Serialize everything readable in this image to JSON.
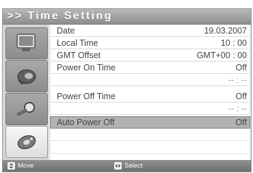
{
  "header": {
    "title": ">> Time Setting"
  },
  "sidebar": {
    "tabs": [
      {
        "icon": "tv-icon"
      },
      {
        "icon": "speaker-icon"
      },
      {
        "icon": "magnifier-icon"
      },
      {
        "icon": "settings-disc-icon",
        "active": true
      }
    ]
  },
  "settings": {
    "rows": [
      {
        "label": "Date",
        "value": "19.03.2007"
      },
      {
        "label": "Local Time",
        "value": "10 : 00"
      },
      {
        "label": "GMT Offset",
        "value": "GMT+00 : 00"
      },
      {
        "label": "Power On Time",
        "value": "Off"
      },
      {
        "label": "",
        "value": "-- : --"
      },
      {
        "label": "Power Off Time",
        "value": "Off"
      },
      {
        "label": "",
        "value": "-- : --"
      },
      {
        "label": "Auto Power Off",
        "value": "Off",
        "selected": true
      }
    ]
  },
  "footer": {
    "move_label": "Move",
    "select_label": "Select"
  }
}
